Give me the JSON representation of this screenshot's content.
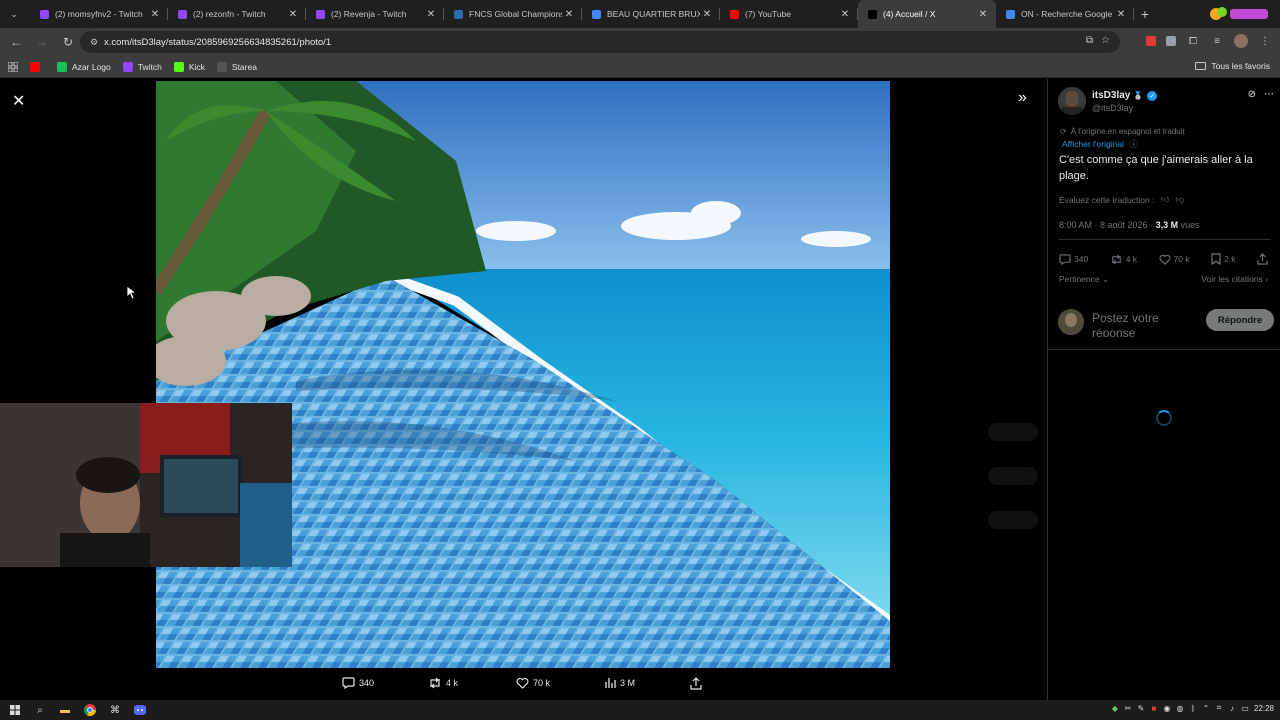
{
  "browser": {
    "tabs": [
      {
        "title": "(2) momsyfnv2 - Twitch",
        "icon": "twitch-icon",
        "color": "#9146ff",
        "active": false
      },
      {
        "title": "(2) rezonfn - Twitch",
        "icon": "twitch-icon",
        "color": "#9146ff",
        "active": false
      },
      {
        "title": "(2) Revenja - Twitch",
        "icon": "twitch-icon",
        "color": "#9146ff",
        "active": false
      },
      {
        "title": "FNCS Global Championsh",
        "icon": "fortnite-icon",
        "color": "#2b6cb0",
        "active": false
      },
      {
        "title": "BEAU QUARTIER BRUXELL",
        "icon": "google-icon",
        "color": "#4285f4",
        "active": false
      },
      {
        "title": "(7) YouTube",
        "icon": "youtube-icon",
        "color": "#ff0000",
        "active": false
      },
      {
        "title": "(4) Accueil / X",
        "icon": "x-icon",
        "color": "#000000",
        "active": true
      },
      {
        "title": "ON - Recherche Google",
        "icon": "google-icon",
        "color": "#4285f4",
        "active": false
      }
    ],
    "new_tab_label": "+",
    "url": "x.com/itsD3lay/status/2085969256634835261/photo/1",
    "bookmarks": [
      {
        "label": "",
        "icon": "youtube-icon",
        "color": "#ff0000"
      },
      {
        "label": "Azar Logo",
        "icon": "azar-icon",
        "color": "#14c45a"
      },
      {
        "label": "Twitch",
        "icon": "twitch-icon",
        "color": "#9146ff"
      },
      {
        "label": "Kick",
        "icon": "kick-icon",
        "color": "#53fc18"
      },
      {
        "label": "Starea",
        "icon": "starea-icon",
        "color": "#555555"
      }
    ],
    "all_bookmarks_label": "Tous les favoris"
  },
  "tweet": {
    "author_name": "itsD3lay",
    "author_badge": "🥈",
    "author_handle": "@itsD3lay",
    "origin_note": "À l'origine en espagnol et traduit",
    "show_original": "Afficher l'original",
    "text": "C'est comme ça que j'aimerais aller à la plage.",
    "rate_translation": "Évaluez cette traduction :",
    "time": "8:00 AM · 8 août 2026 · ",
    "views_count": "3,3 M",
    "views_label": "vues",
    "stats": {
      "replies": "340",
      "reposts": "4 k",
      "likes": "70 k",
      "bookmarks": "2 k"
    },
    "sort_label": "Pertinence",
    "quotes_label": "Voir les citations",
    "reply_placeholder": "Postez votre réponse",
    "reply_button": "Répondre"
  },
  "photo_actions": {
    "replies": "340",
    "reposts": "4 k",
    "likes": "70 k",
    "views": "3 M"
  },
  "taskbar": {
    "clock": "22:28"
  },
  "colors": {
    "accent": "#1d9bf0",
    "background": "#000000",
    "muted": "#71767b"
  }
}
